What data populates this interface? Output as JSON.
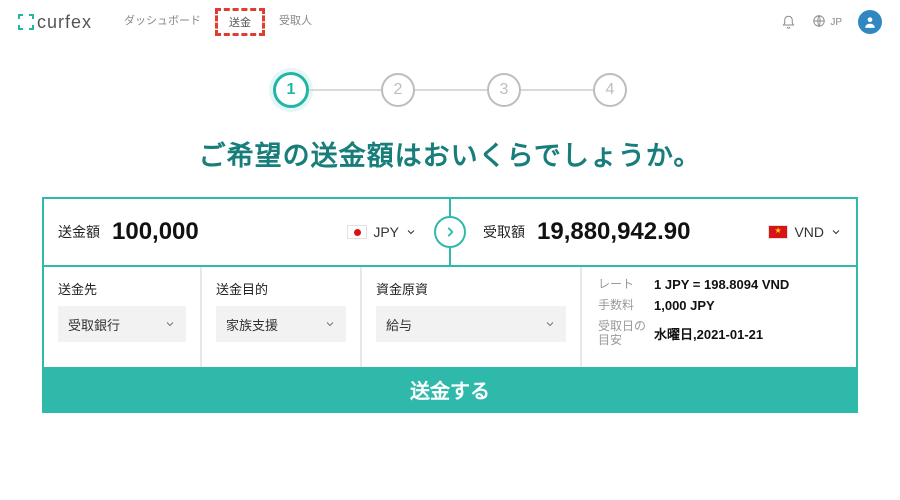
{
  "header": {
    "brand": "curfex",
    "nav": {
      "dashboard": "ダッシュボード",
      "transfer": "送金",
      "recipients": "受取人"
    },
    "lang": "JP"
  },
  "steps": [
    "1",
    "2",
    "3",
    "4"
  ],
  "title": "ご希望の送金額はおいくらでしょうか。",
  "send": {
    "label": "送金額",
    "value": "100,000",
    "currency": "JPY"
  },
  "recv": {
    "label": "受取額",
    "value": "19,880,942.90",
    "currency": "VND"
  },
  "options": {
    "destination": {
      "label": "送金先",
      "value": "受取銀行"
    },
    "purpose": {
      "label": "送金目的",
      "value": "家族支援"
    },
    "source": {
      "label": "資金原資",
      "value": "給与"
    }
  },
  "info": {
    "rate": {
      "label": "レート",
      "value": "1 JPY = 198.8094 VND"
    },
    "fee": {
      "label": "手数料",
      "value": "1,000 JPY"
    },
    "eta": {
      "label": "受取日の目安",
      "value": "水曜日,2021-01-21"
    }
  },
  "submit": "送金する"
}
